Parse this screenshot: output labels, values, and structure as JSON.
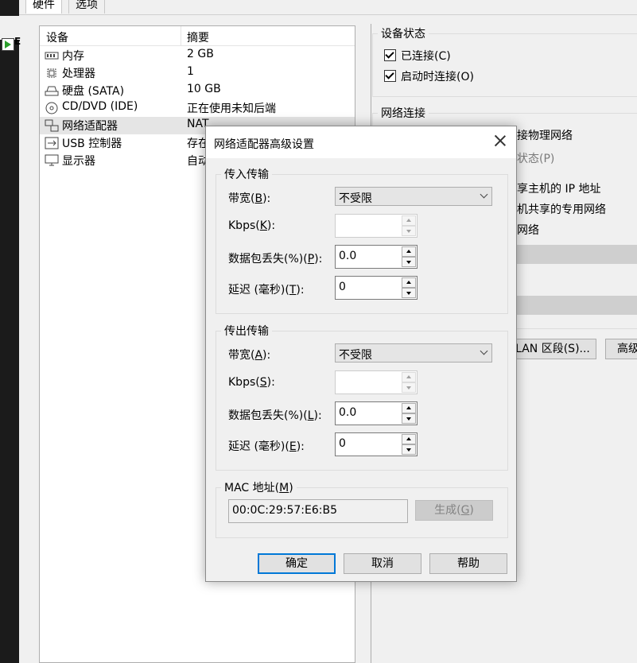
{
  "vm_panel": {
    "letter": "E"
  },
  "tabs": [
    {
      "label": "硬件"
    },
    {
      "label": "选项"
    }
  ],
  "devices": {
    "col_device": "设备",
    "col_summary": "摘要",
    "items": [
      {
        "name": "内存",
        "summary": "2 GB",
        "icon": "memory-icon"
      },
      {
        "name": "处理器",
        "summary": "1",
        "icon": "cpu-icon"
      },
      {
        "name": "硬盘 (SATA)",
        "summary": "10 GB",
        "icon": "harddisk-icon"
      },
      {
        "name": "CD/DVD (IDE)",
        "summary": "正在使用未知后端",
        "icon": "cd-icon"
      },
      {
        "name": "网络适配器",
        "summary": "NAT",
        "icon": "network-icon"
      },
      {
        "name": "USB 控制器",
        "summary": "存在",
        "icon": "usb-icon"
      },
      {
        "name": "显示器",
        "summary": "自动",
        "icon": "monitor-icon"
      }
    ]
  },
  "device_status": {
    "title": "设备状态",
    "connected": "已连接(C)",
    "connect_at_power_on": "启动时连接(O)"
  },
  "network": {
    "title": "网络连接",
    "frag1": "接物理网络",
    "frag2": "状态(P)",
    "frag3": "享主机的 IP 地址",
    "frag4": "机共享的专用网络",
    "frag5": "网络",
    "lan_button": "LAN 区段(S)...",
    "adv_button": "高级"
  },
  "dialog": {
    "title": "网络适配器高级设置",
    "incoming": {
      "title": "传入传输",
      "bandwidth_label": "带宽(",
      "bandwidth_key": "B",
      "bandwidth_value": "不受限",
      "kbps_label": "Kbps(",
      "kbps_key": "K",
      "kbps_value": "",
      "loss_label": "数据包丢失(%)(",
      "loss_key": "P",
      "loss_value": "0.0",
      "latency_label": "延迟 (毫秒)(",
      "latency_key": "T",
      "latency_value": "0"
    },
    "outgoing": {
      "title": "传出传输",
      "bandwidth_label": "带宽(",
      "bandwidth_key": "A",
      "bandwidth_value": "不受限",
      "kbps_label": "Kbps(",
      "kbps_key": "S",
      "kbps_value": "",
      "loss_label": "数据包丢失(%)(",
      "loss_key": "L",
      "loss_value": "0.0",
      "latency_label": "延迟 (毫秒)(",
      "latency_key": "E",
      "latency_value": "0"
    },
    "label_tail": "):",
    "mac": {
      "title": "MAC 地址(",
      "key": "M",
      "tail": ")",
      "value": "00:0C:29:57:E6:B5",
      "generate_label": "生成(",
      "generate_key": "G",
      "generate_tail": ")"
    },
    "ok": "确定",
    "cancel": "取消",
    "help": "帮助"
  },
  "colors": {
    "accent": "#0078d7",
    "selection": "#e5e5e5"
  }
}
